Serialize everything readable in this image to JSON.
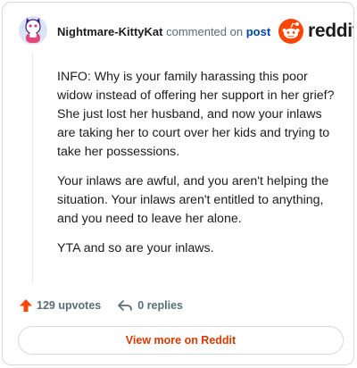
{
  "comment": {
    "username": "Nightmare-KittyKat",
    "action_text": "commented on",
    "post_link": "post",
    "avatar_icon": "snoo-avatar-icon",
    "paragraphs": [
      "INFO: Why is your family harassing this poor widow instead of offering her support in her grief? She just lost her husband, and now your inlaws are taking her to court over her kids and trying to take her possessions.",
      "Your inlaws are awful, and you aren't helping the situation. Your inlaws aren't entitled to anything, and you need to leave her alone.",
      "YTA and so are your inlaws."
    ]
  },
  "brand": {
    "logo_icon": "reddit-snoo-icon",
    "wordmark": "reddit",
    "color": "#ff4500"
  },
  "footer": {
    "upvote_icon": "upvote-arrow-icon",
    "upvotes": "129 upvotes",
    "reply_icon": "reply-arrow-icon",
    "replies": "0 replies",
    "view_more_label": "View more on Reddit",
    "upvote_color": "#ff4500",
    "view_more_color": "#d93a00"
  }
}
